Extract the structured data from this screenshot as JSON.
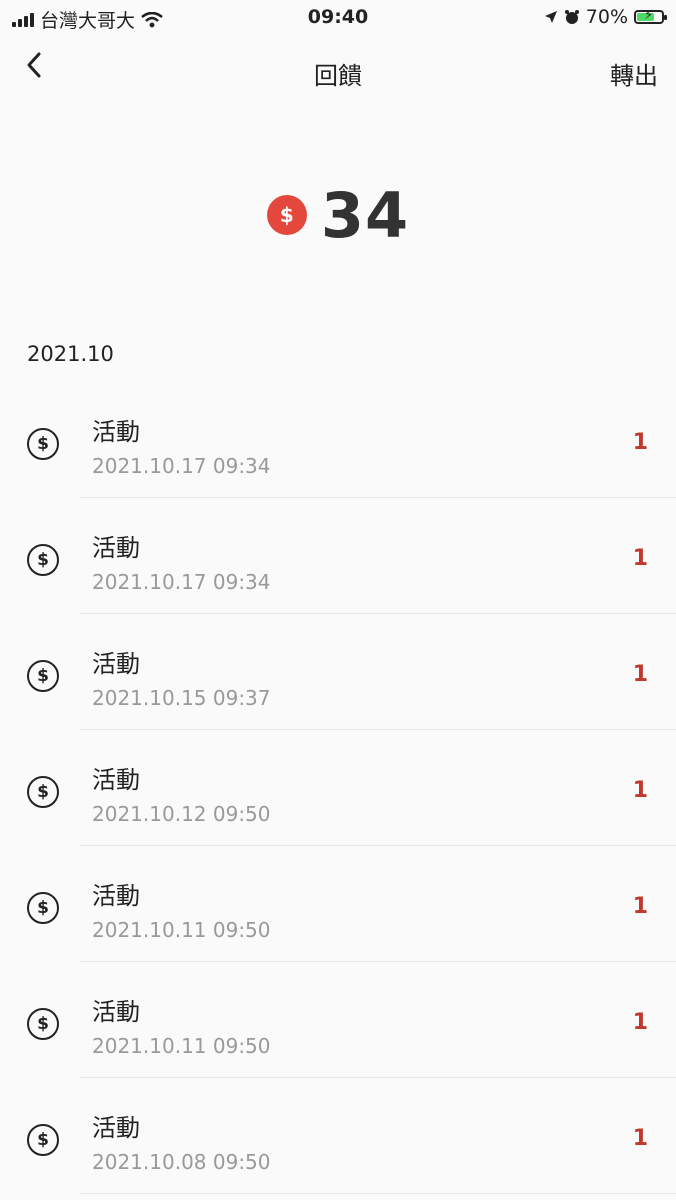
{
  "status_bar": {
    "carrier": "台灣大哥大",
    "time": "09:40",
    "battery_text": "70%",
    "battery_level": 0.7
  },
  "nav": {
    "back_icon": "chevron-left-icon",
    "title": "回饋",
    "action_label": "轉出"
  },
  "balance": {
    "coin_symbol": "$",
    "value": "34",
    "coin_color": "#e4473c"
  },
  "month_header": "2021.10",
  "transactions": [
    {
      "icon": "$",
      "title": "活動",
      "time": "2021.10.17 09:34",
      "amount": "1"
    },
    {
      "icon": "$",
      "title": "活動",
      "time": "2021.10.17 09:34",
      "amount": "1"
    },
    {
      "icon": "$",
      "title": "活動",
      "time": "2021.10.15 09:37",
      "amount": "1"
    },
    {
      "icon": "$",
      "title": "活動",
      "time": "2021.10.12 09:50",
      "amount": "1"
    },
    {
      "icon": "$",
      "title": "活動",
      "time": "2021.10.11 09:50",
      "amount": "1"
    },
    {
      "icon": "$",
      "title": "活動",
      "time": "2021.10.11 09:50",
      "amount": "1"
    },
    {
      "icon": "$",
      "title": "活動",
      "time": "2021.10.08 09:50",
      "amount": "1"
    }
  ],
  "colors": {
    "amount": "#c0392b",
    "secondary_text": "#999999",
    "background": "#fafafa"
  }
}
